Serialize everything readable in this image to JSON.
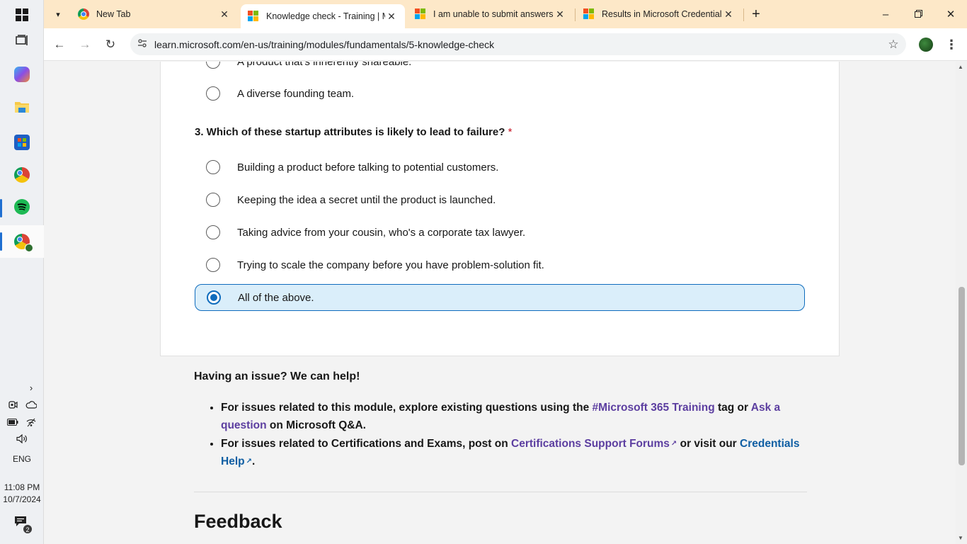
{
  "taskbar": {
    "apps": [
      {
        "name": "windows-start",
        "icon": "windows-logo-icon"
      },
      {
        "name": "task-view",
        "icon": "task-view-icon"
      },
      {
        "name": "copilot",
        "icon": "copilot-icon"
      },
      {
        "name": "file-explorer",
        "icon": "folder-icon"
      },
      {
        "name": "microsoft-store",
        "icon": "store-icon"
      },
      {
        "name": "chrome",
        "icon": "chrome-icon"
      },
      {
        "name": "spotify",
        "icon": "spotify-icon"
      },
      {
        "name": "chrome-profile",
        "icon": "chrome-profile-icon"
      }
    ],
    "tray": {
      "language": "ENG",
      "time": "11:08 PM",
      "date": "10/7/2024",
      "notification_count": "2"
    }
  },
  "browser": {
    "tabs": [
      {
        "title": "New Tab",
        "favicon": "chrome-icon",
        "active": false
      },
      {
        "title": "Knowledge check - Training | M",
        "favicon": "microsoft-icon",
        "active": true
      },
      {
        "title": "I am unable to submit answers f",
        "favicon": "microsoft-icon",
        "active": false
      },
      {
        "title": "Results in Microsoft Credentials",
        "favicon": "microsoft-icon",
        "active": false
      }
    ],
    "url": "learn.microsoft.com/en-us/training/modules/fundamentals/5-knowledge-check"
  },
  "quiz": {
    "prev_options": [
      "A product that's inherently shareable.",
      "A diverse founding team."
    ],
    "question3": {
      "text": "3. Which of these startup attributes is likely to lead to failure?",
      "required_mark": "*",
      "options": [
        "Building a product before talking to potential customers.",
        "Keeping the idea a secret until the product is launched.",
        "Taking advice from your cousin, who's a corporate tax lawyer.",
        "Trying to scale the company before you have problem-solution fit.",
        "All of the above."
      ],
      "selected": "All of the above."
    }
  },
  "help": {
    "title": "Having an issue? We can help!",
    "item1": {
      "before": "For issues related to this module, explore existing questions using the ",
      "link1": "#Microsoft 365 Training",
      "middle": " tag or ",
      "link2": "Ask a question",
      "after": " on Microsoft Q&A."
    },
    "item2": {
      "before": "For issues related to Certifications and Exams, post on ",
      "link1": "Certifications Support Forums",
      "middle": " or visit our ",
      "link2": "Credentials Help",
      "after": "."
    }
  },
  "feedback_title": "Feedback",
  "colors": {
    "tabstrip": "#fde8c8",
    "selected_bg": "#daeefa",
    "accent": "#0f6cbd",
    "required": "#c50f1f"
  }
}
